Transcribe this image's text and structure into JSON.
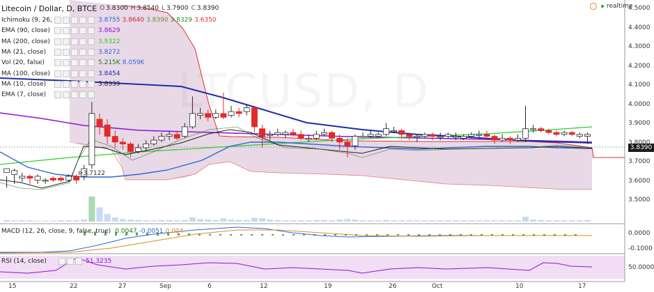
{
  "header": {
    "title": "Litecoin / Dollar, D, BTCE",
    "ohlc": [
      {
        "k": "O",
        "v": "3.8300"
      },
      {
        "k": "H",
        "v": "3.8540"
      },
      {
        "k": "L",
        "v": "3.7900"
      },
      {
        "k": "C",
        "v": "3.8390"
      }
    ],
    "realtime_label": "realtime"
  },
  "watermark": "LTCUSD, D",
  "studies": [
    {
      "name": "Ichimoku (9, 26, 52, 26)",
      "values": [
        {
          "v": "3.8755",
          "color": "#2c67d6"
        },
        {
          "v": "3.8640",
          "color": "#c03030"
        },
        {
          "v": "3.8390",
          "color": "#6b8e3a"
        },
        {
          "v": "3.8329",
          "color": "#2b8c2b"
        },
        {
          "v": "3.6350",
          "color": "#e03030"
        }
      ]
    },
    {
      "name": "EMA (90, close)",
      "values": [
        {
          "v": "3.8629",
          "color": "#8a17d6"
        }
      ]
    },
    {
      "name": "MA (200, close)",
      "values": [
        {
          "v": "3.9322",
          "color": "#2fcf2f"
        }
      ]
    },
    {
      "name": "MA (21, close)",
      "values": [
        {
          "v": "3.8272",
          "color": "#2c67d6"
        }
      ]
    },
    {
      "name": "Vol (20, false)",
      "values": [
        {
          "v": "5.215K",
          "color": "#1e7a1e"
        },
        {
          "v": "8.059K",
          "color": "#2c67d6"
        }
      ]
    },
    {
      "name": "MA (100, close)",
      "values": [
        {
          "v": "3.8454",
          "color": "#1c2fa8"
        }
      ]
    },
    {
      "name": "MA (10, close)",
      "values": [
        {
          "v": "3.8339",
          "color": "#222222"
        }
      ]
    },
    {
      "name": "EMA (7, close)",
      "values": []
    }
  ],
  "annotation": "3.7122",
  "price_axis": {
    "ticks": [
      "4.5000",
      "4.4000",
      "4.3000",
      "4.2000",
      "4.1000",
      "4.0000",
      "3.9000",
      "3.8000",
      "3.7000",
      "3.6000",
      "3.5000"
    ],
    "current": "3.8390"
  },
  "macd": {
    "label": "MACD (12, 26, close, 9, false, true)",
    "values": [
      {
        "v": "0.0047",
        "color": "#1e7a1e"
      },
      {
        "v": "-0.0051",
        "color": "#2c67d6"
      },
      {
        "v": "0.004",
        "color": "#e08a1e"
      }
    ],
    "ticks": [
      "0.0000",
      "-0.1000"
    ]
  },
  "rsi": {
    "label": "RSI (14, close)",
    "value": "51.3235",
    "ticks": [
      "50.0000"
    ]
  },
  "time_axis": [
    "15",
    "22",
    "27",
    "Sep",
    "6",
    "12",
    "19",
    "26",
    "Oct",
    "10",
    "17"
  ],
  "colors": {
    "bull": "#2a2a2a",
    "bear": "#e02b2b",
    "cloud": "#9b4f8f",
    "ema90": "#8a17d6",
    "ma200": "#2fcf2f",
    "ma100": "#1c2fa8",
    "ma21": "#2c67d6",
    "ma10": "#222222"
  }
}
